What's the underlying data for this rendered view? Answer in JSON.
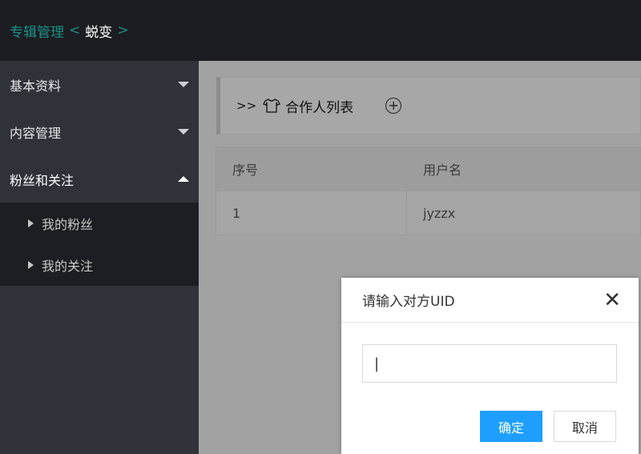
{
  "topbar": {
    "breadcrumb_root": "专辑管理",
    "sep_left": "<",
    "current": "蜕变",
    "sep_right": ">"
  },
  "sidebar": {
    "items": [
      {
        "label": "基本资料",
        "expanded": false
      },
      {
        "label": "内容管理",
        "expanded": false
      },
      {
        "label": "粉丝和关注",
        "expanded": true
      }
    ],
    "subitems": [
      {
        "label": "我的粉丝"
      },
      {
        "label": "我的关注"
      }
    ]
  },
  "panel": {
    "arrows": ">>",
    "title": "合作人列表",
    "shirt_icon": "shirt-icon",
    "add_icon": "plus-circle-icon"
  },
  "table": {
    "headers": [
      "序号",
      "用户名"
    ],
    "rows": [
      [
        "1",
        "jyzzx"
      ]
    ]
  },
  "dialog": {
    "title": "请输入对方UID",
    "close_glyph": "✕",
    "input_value": "|",
    "ok_label": "确定",
    "cancel_label": "取消"
  },
  "colors": {
    "accent_teal": "#1a8f83",
    "primary_button": "#1e9fff",
    "topbar_bg": "#1c1d22",
    "sidebar_bg": "#30323a"
  }
}
